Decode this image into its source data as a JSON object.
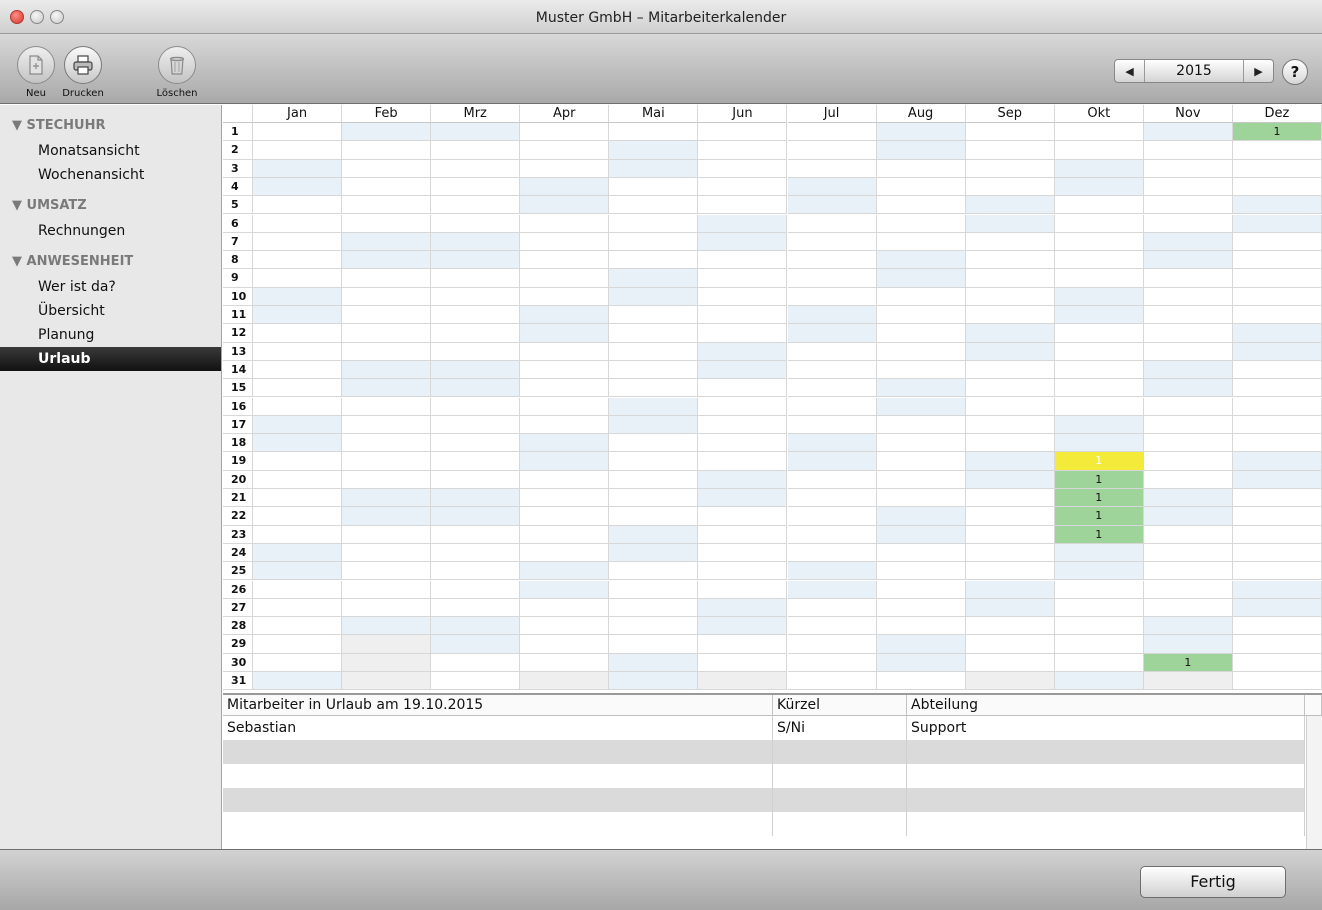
{
  "window": {
    "title": "Muster GmbH – Mitarbeiterkalender"
  },
  "toolbar": {
    "new_label": "Neu",
    "print_label": "Drucken",
    "delete_label": "Löschen",
    "year": "2015",
    "help_label": "?"
  },
  "sidebar": {
    "groups": [
      {
        "label": "▼ STECHUHR",
        "items": [
          "Monatsansicht",
          "Wochenansicht"
        ]
      },
      {
        "label": "▼ UMSATZ",
        "items": [
          "Rechnungen"
        ]
      },
      {
        "label": "▼ ANWESENHEIT",
        "items": [
          "Wer ist da?",
          "Übersicht",
          "Planung",
          "Urlaub"
        ]
      }
    ],
    "selected": "Urlaub"
  },
  "calendar": {
    "months": [
      "Jan",
      "Feb",
      "Mrz",
      "Apr",
      "Mai",
      "Jun",
      "Jul",
      "Aug",
      "Sep",
      "Okt",
      "Nov",
      "Dez"
    ],
    "days": [
      "1",
      "2",
      "3",
      "4",
      "5",
      "6",
      "7",
      "8",
      "9",
      "10",
      "11",
      "12",
      "13",
      "14",
      "15",
      "16",
      "17",
      "18",
      "19",
      "20",
      "21",
      "22",
      "23",
      "24",
      "25",
      "26",
      "27",
      "28",
      "29",
      "30",
      "31"
    ],
    "entries": [
      {
        "month": 12,
        "day": 1,
        "count": "1",
        "status": "vacation"
      },
      {
        "month": 10,
        "day": 19,
        "count": "1",
        "status": "selected"
      },
      {
        "month": 10,
        "day": 20,
        "count": "1",
        "status": "vacation"
      },
      {
        "month": 10,
        "day": 21,
        "count": "1",
        "status": "vacation"
      },
      {
        "month": 10,
        "day": 22,
        "count": "1",
        "status": "vacation"
      },
      {
        "month": 10,
        "day": 23,
        "count": "1",
        "status": "vacation"
      },
      {
        "month": 11,
        "day": 30,
        "count": "1",
        "status": "vacation"
      }
    ],
    "colors": {
      "weekend": "#e8f0f8",
      "invalid": "#efefef",
      "vacation": "#9ed39a",
      "selected": "#f3ea3a"
    }
  },
  "detail": {
    "columns": [
      "Mitarbeiter in Urlaub am 19.10.2015",
      "Kürzel",
      "Abteilung"
    ],
    "rows": [
      [
        "Sebastian",
        "S/Ni",
        "Support"
      ]
    ]
  },
  "footer": {
    "done_label": "Fertig"
  }
}
